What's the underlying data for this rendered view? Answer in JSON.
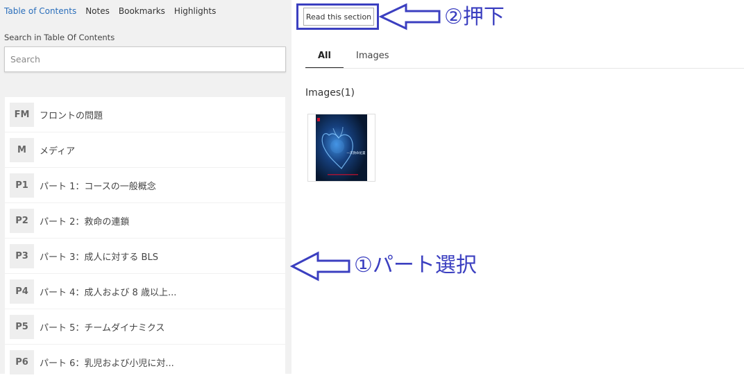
{
  "sidebar": {
    "tabs": [
      "Table of Contents",
      "Notes",
      "Bookmarks",
      "Highlights"
    ],
    "active_tab": 0,
    "search_label": "Search in Table Of Contents",
    "search_placeholder": "Search",
    "items": [
      {
        "code": "FM",
        "title": "フロントの問題"
      },
      {
        "code": "M",
        "title": "メディア"
      },
      {
        "code": "P1",
        "title": "パート 1：コースの一般概念"
      },
      {
        "code": "P2",
        "title": "パート 2：救命の連鎖"
      },
      {
        "code": "P3",
        "title": "パート 3：成人に対する BLS"
      },
      {
        "code": "P4",
        "title": "パート 4：成人および 8 歳以上..."
      },
      {
        "code": "P5",
        "title": "パート 5：チームダイナミクス"
      },
      {
        "code": "P6",
        "title": "パート 6：乳児および小児に対..."
      }
    ]
  },
  "main": {
    "read_button": "Read this section",
    "tabs": [
      "All",
      "Images"
    ],
    "active_tab": 0,
    "images_heading": "Images(1)",
    "thumbnail_caption": "一次救命処置"
  },
  "annotations": {
    "step2": "②押下",
    "step1": "①パート選択",
    "color": "#3b3fc0"
  },
  "colors": {
    "link_active": "#2a6ebb",
    "sidebar_bg": "#f1f1f1",
    "cover_dark": "#0a1e3c",
    "cover_red": "#c8102e"
  }
}
